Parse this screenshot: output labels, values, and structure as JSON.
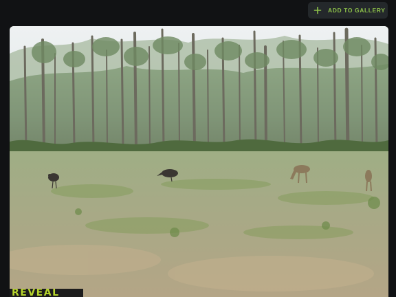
{
  "toolbar": {
    "add_to_gallery_label": "ADD TO GALLERY",
    "add_icon": "plus-icon",
    "accent_color": "#8ec24a"
  },
  "photo": {
    "subject": "trail camera image of a clearing with wild turkeys and deer in front of a pine forest",
    "watermark_text": "REVEAL",
    "watermark_color": "#b7d52c"
  }
}
